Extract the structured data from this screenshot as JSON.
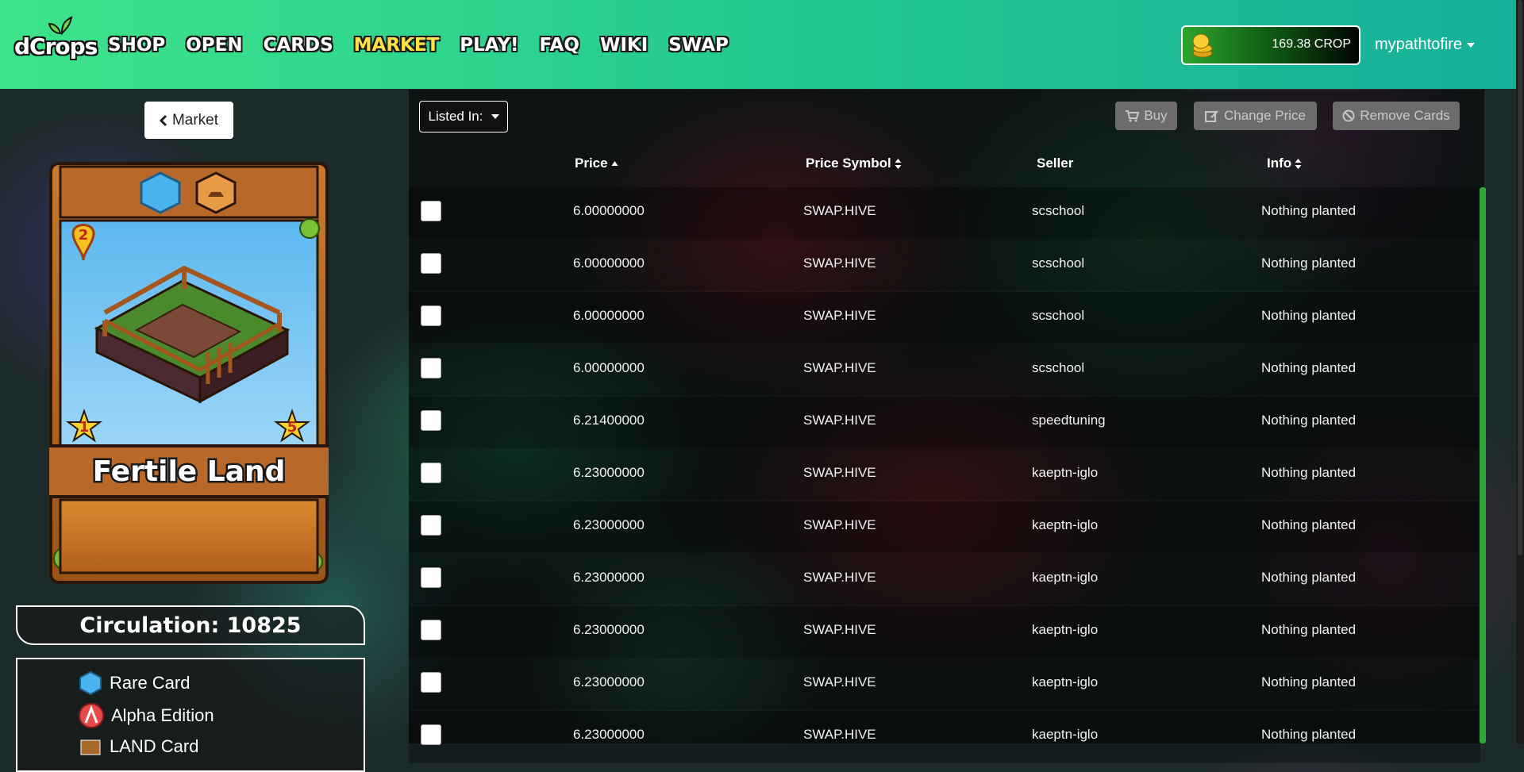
{
  "nav": {
    "logo_text": "dCrops",
    "links": [
      "SHOP",
      "OPEN",
      "CARDS",
      "MARKET",
      "PLAY!",
      "FAQ",
      "WIKI",
      "SWAP"
    ],
    "active": "MARKET",
    "balance": "169.38 CROP",
    "username": "mypathtofire"
  },
  "left": {
    "back_label": "Market",
    "card": {
      "name": "Fertile Land",
      "level": "2",
      "left_star": "1",
      "right_star": "5"
    },
    "circulation": "Circulation: 10825",
    "info_items": [
      "Rare Card",
      "Alpha Edition",
      "LAND Card"
    ]
  },
  "toolbar": {
    "listed_in_label": "Listed In:",
    "buy_label": "Buy",
    "change_price_label": "Change Price",
    "remove_label": "Remove Cards"
  },
  "table": {
    "headers": [
      "Price",
      "Price Symbol",
      "Seller",
      "Info"
    ],
    "rows": [
      {
        "price": "6.00000000",
        "symbol": "SWAP.HIVE",
        "seller": "scschool",
        "info": "Nothing planted"
      },
      {
        "price": "6.00000000",
        "symbol": "SWAP.HIVE",
        "seller": "scschool",
        "info": "Nothing planted"
      },
      {
        "price": "6.00000000",
        "symbol": "SWAP.HIVE",
        "seller": "scschool",
        "info": "Nothing planted"
      },
      {
        "price": "6.00000000",
        "symbol": "SWAP.HIVE",
        "seller": "scschool",
        "info": "Nothing planted"
      },
      {
        "price": "6.21400000",
        "symbol": "SWAP.HIVE",
        "seller": "speedtuning",
        "info": "Nothing planted"
      },
      {
        "price": "6.23000000",
        "symbol": "SWAP.HIVE",
        "seller": "kaeptn-iglo",
        "info": "Nothing planted"
      },
      {
        "price": "6.23000000",
        "symbol": "SWAP.HIVE",
        "seller": "kaeptn-iglo",
        "info": "Nothing planted"
      },
      {
        "price": "6.23000000",
        "symbol": "SWAP.HIVE",
        "seller": "kaeptn-iglo",
        "info": "Nothing planted"
      },
      {
        "price": "6.23000000",
        "symbol": "SWAP.HIVE",
        "seller": "kaeptn-iglo",
        "info": "Nothing planted"
      },
      {
        "price": "6.23000000",
        "symbol": "SWAP.HIVE",
        "seller": "kaeptn-iglo",
        "info": "Nothing planted"
      },
      {
        "price": "6.23000000",
        "symbol": "SWAP.HIVE",
        "seller": "kaeptn-iglo",
        "info": "Nothing planted"
      }
    ]
  },
  "colors": {
    "nav_start": "#3ee48a",
    "nav_end": "#17b09a",
    "active_link": "#ffe24a",
    "rare_blue": "#3aa7e8"
  }
}
